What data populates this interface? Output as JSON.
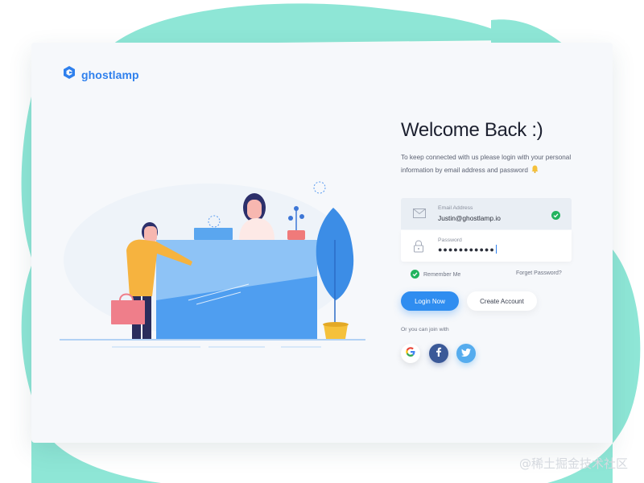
{
  "brand": {
    "name": "ghostlamp",
    "logo_icon": "ghostlamp-logo-icon",
    "accent": "#2f80ed"
  },
  "background": {
    "blob_color": "#8ee6d6"
  },
  "login": {
    "title": "Welcome Back :)",
    "subtitle": "To keep connected with us please login with your personal information by email address and password",
    "email": {
      "label": "Email Address",
      "value": "Justin@ghostlamp.io",
      "icon": "mail-icon",
      "valid_icon": "check-circle-icon"
    },
    "password": {
      "label": "Password",
      "value": "●●●●●●●●●●●",
      "icon": "lock-icon"
    },
    "remember_label": "Remember Me",
    "remember_checked": true,
    "forgot_label": "Forget Password?",
    "login_button": "Login Now",
    "create_button": "Create Account",
    "social_label": "Or you can join with",
    "social": [
      "google",
      "facebook",
      "twitter"
    ],
    "button_color": "#2f8df0"
  },
  "watermark": "@稀土掘金技术社区"
}
